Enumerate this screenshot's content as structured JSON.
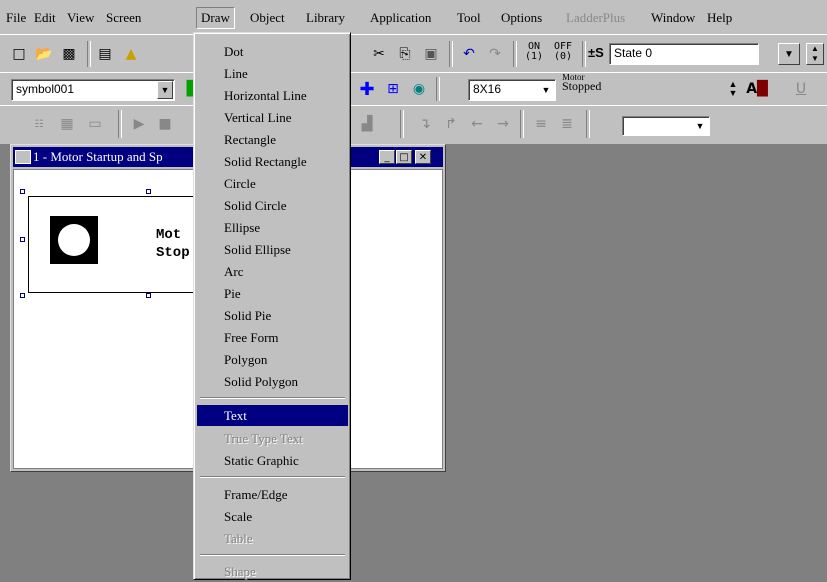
{
  "menubar": {
    "items": [
      {
        "label": "File",
        "state": "normal"
      },
      {
        "label": "Edit",
        "state": "normal"
      },
      {
        "label": "View",
        "state": "normal"
      },
      {
        "label": "Screen",
        "state": "normal"
      },
      {
        "label": "Draw",
        "state": "active"
      },
      {
        "label": "Object",
        "state": "normal"
      },
      {
        "label": "Library",
        "state": "normal"
      },
      {
        "label": "Application",
        "state": "normal"
      },
      {
        "label": "Tool",
        "state": "normal"
      },
      {
        "label": "Options",
        "state": "normal"
      },
      {
        "label": "LadderPlus",
        "state": "disabled"
      },
      {
        "label": "Window",
        "state": "normal"
      },
      {
        "label": "Help",
        "state": "normal"
      }
    ]
  },
  "toolbar1": {
    "on_label": "ON",
    "on_sub": "(1)",
    "off_label": "OFF",
    "off_sub": "(0)",
    "state_toggle_label": "±S",
    "state_value": "State 0"
  },
  "toolbar2": {
    "symbol_value": "symbol001",
    "font_size_value": "8X16",
    "text_preview_top": "Motor",
    "text_preview_value": "Stopped"
  },
  "child_window": {
    "title": "1 - Motor Startup and Sp",
    "text_line1": "Mot",
    "text_line2": "Stop"
  },
  "draw_menu": {
    "items": [
      {
        "label": "Dot",
        "state": "normal"
      },
      {
        "label": "Line",
        "state": "normal"
      },
      {
        "label": "Horizontal Line",
        "state": "normal"
      },
      {
        "label": "Vertical Line",
        "state": "normal"
      },
      {
        "label": "Rectangle",
        "state": "normal"
      },
      {
        "label": "Solid Rectangle",
        "state": "normal"
      },
      {
        "label": "Circle",
        "state": "normal"
      },
      {
        "label": "Solid Circle",
        "state": "normal"
      },
      {
        "label": "Ellipse",
        "state": "normal"
      },
      {
        "label": "Solid Ellipse",
        "state": "normal"
      },
      {
        "label": "Arc",
        "state": "normal"
      },
      {
        "label": "Pie",
        "state": "normal"
      },
      {
        "label": "Solid Pie",
        "state": "normal"
      },
      {
        "label": "Free Form",
        "state": "normal"
      },
      {
        "label": "Polygon",
        "state": "normal"
      },
      {
        "label": "Solid Polygon",
        "state": "normal"
      },
      {
        "label": "Text",
        "state": "selected"
      },
      {
        "label": "True Type Text",
        "state": "disabled"
      },
      {
        "label": "Static Graphic",
        "state": "normal"
      },
      {
        "label": "Frame/Edge",
        "state": "normal"
      },
      {
        "label": "Scale",
        "state": "normal"
      },
      {
        "label": "Table",
        "state": "disabled"
      },
      {
        "label": "Shape",
        "state": "disabled"
      }
    ]
  },
  "colors": {
    "selection": "#000080",
    "face": "#c0c0c0",
    "workspace": "#808080"
  }
}
